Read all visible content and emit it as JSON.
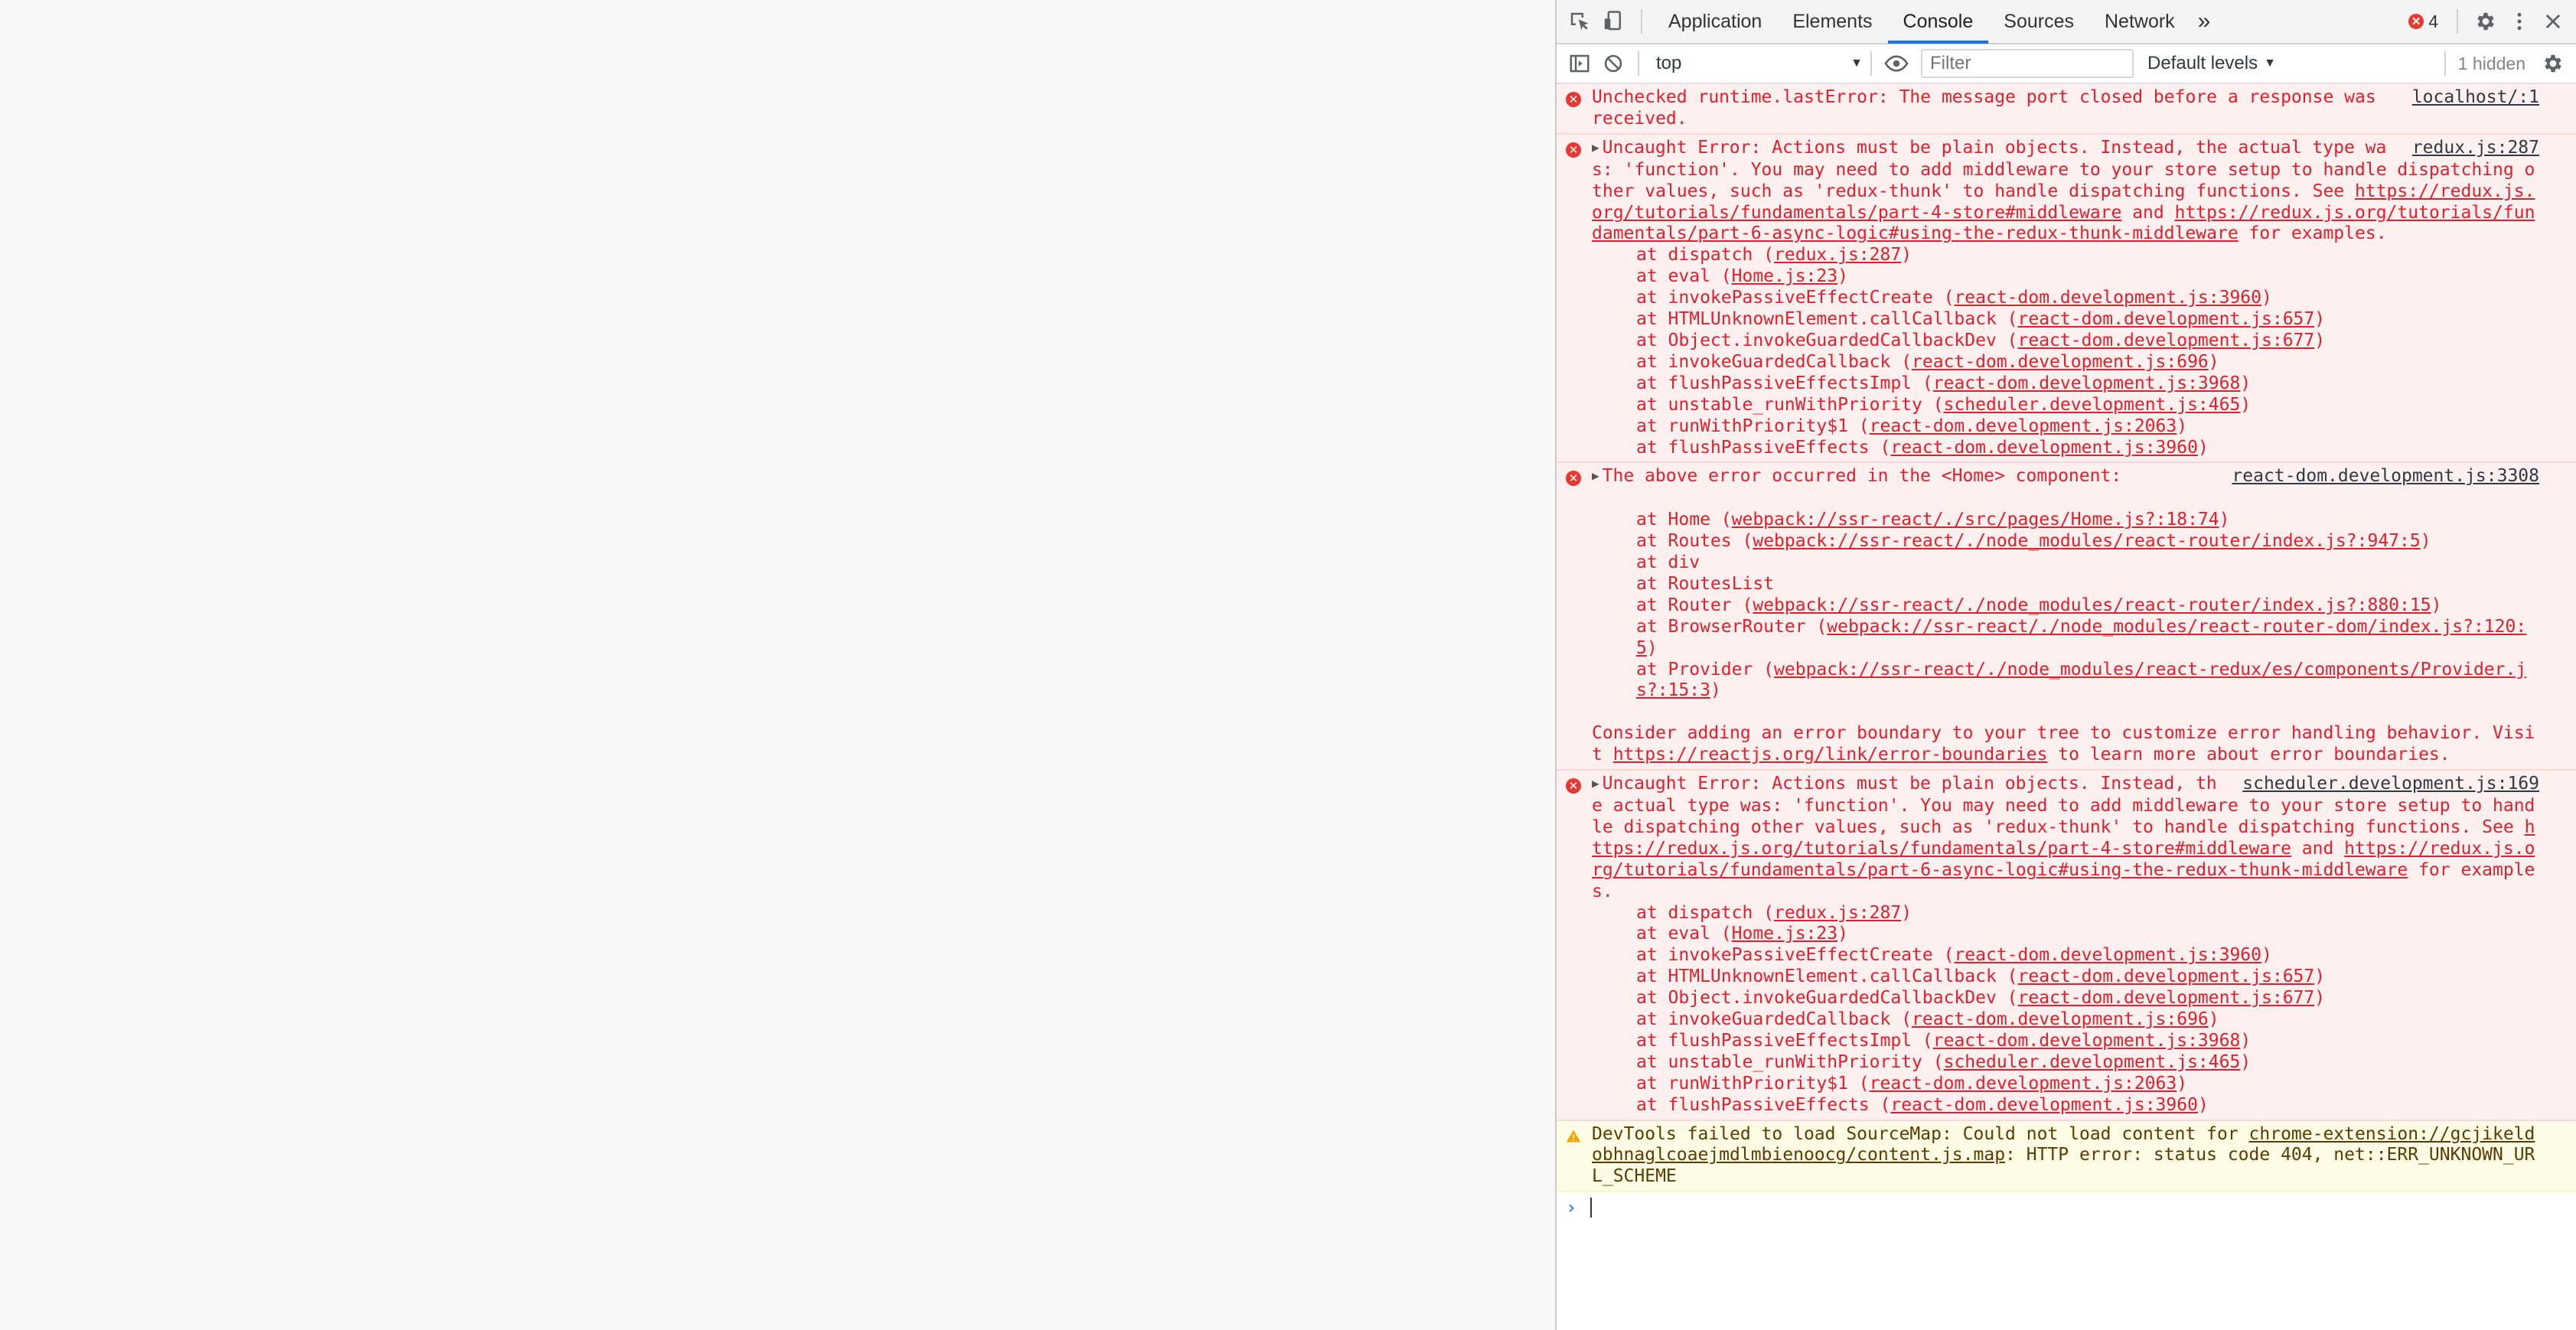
{
  "tabs": [
    "Application",
    "Elements",
    "Console",
    "Sources",
    "Network"
  ],
  "active_tab": "Console",
  "more_tabs_label": "»",
  "error_count": "4",
  "toolbar": {
    "context": "top",
    "filter_placeholder": "Filter",
    "levels": "Default levels",
    "hidden": "1 hidden"
  },
  "icons": {
    "inspect": "inspect-element-icon",
    "device": "device-toolbar-icon",
    "settings": "gear-icon",
    "menu": "more-vert-icon",
    "close": "close-icon",
    "sidebar": "sidebar-toggle-icon",
    "clear": "clear-console-icon",
    "eye": "live-expression-icon"
  },
  "colors": {
    "error_bg": "#fff0f0",
    "error_text": "#e0212d",
    "warn_bg": "#fffbe5",
    "accent": "#1a73e8"
  },
  "messages": [
    {
      "type": "error",
      "expandable": false,
      "source": "localhost/:1",
      "text": [
        {
          "t": "Unchecked runtime.lastError: The message port closed before a response was received."
        }
      ],
      "stack": []
    },
    {
      "type": "error",
      "expandable": true,
      "source": "redux.js:287",
      "text": [
        {
          "t": "Uncaught Error: Actions must be plain objects. Instead, the actual type was: 'function'. You may need to add middleware to your store setup to handle dispatching other values, such as 'redux-thunk' to handle dispatching functions. See "
        },
        {
          "t": "https://redux.js.org/tutorials/fundamentals/part-4-store#middleware",
          "link": true
        },
        {
          "t": " and "
        },
        {
          "t": "https://redux.js.org/tutorials/fundamentals/part-6-async-logic#using-the-redux-thunk-middleware",
          "link": true
        },
        {
          "t": " for examples."
        }
      ],
      "stack": [
        {
          "fn": "dispatch",
          "loc": "redux.js:287"
        },
        {
          "fn": "eval",
          "loc": "Home.js:23"
        },
        {
          "fn": "invokePassiveEffectCreate",
          "loc": "react-dom.development.js:3960"
        },
        {
          "fn": "HTMLUnknownElement.callCallback",
          "loc": "react-dom.development.js:657"
        },
        {
          "fn": "Object.invokeGuardedCallbackDev",
          "loc": "react-dom.development.js:677"
        },
        {
          "fn": "invokeGuardedCallback",
          "loc": "react-dom.development.js:696"
        },
        {
          "fn": "flushPassiveEffectsImpl",
          "loc": "react-dom.development.js:3968"
        },
        {
          "fn": "unstable_runWithPriority",
          "loc": "scheduler.development.js:465"
        },
        {
          "fn": "runWithPriority$1",
          "loc": "react-dom.development.js:2063"
        },
        {
          "fn": "flushPassiveEffects",
          "loc": "react-dom.development.js:3960"
        }
      ]
    },
    {
      "type": "error",
      "expandable": true,
      "source": "react-dom.development.js:3308",
      "text": [
        {
          "t": "The above error occurred in the <Home> component:"
        }
      ],
      "stack_gap_before": true,
      "stack": [
        {
          "fn": "Home",
          "loc": "webpack://ssr-react/./src/pages/Home.js?:18:74"
        },
        {
          "fn": "Routes",
          "loc": "webpack://ssr-react/./node_modules/react-router/index.js?:947:5"
        },
        {
          "fn": "div"
        },
        {
          "fn": "RoutesList"
        },
        {
          "fn": "Router",
          "loc": "webpack://ssr-react/./node_modules/react-router/index.js?:880:15"
        },
        {
          "fn": "BrowserRouter",
          "loc": "webpack://ssr-react/./node_modules/react-router-dom/index.js?:120:5"
        },
        {
          "fn": "Provider",
          "loc": "webpack://ssr-react/./node_modules/react-redux/es/components/Provider.js?:15:3"
        }
      ],
      "footer": [
        {
          "t": "Consider adding an error boundary to your tree to customize error handling behavior. Visit "
        },
        {
          "t": "https://reactjs.org/link/error-boundaries",
          "link": true
        },
        {
          "t": " to learn more about error boundaries."
        }
      ]
    },
    {
      "type": "error",
      "expandable": true,
      "source": "scheduler.development.js:169",
      "text": [
        {
          "t": "Uncaught Error: Actions must be plain objects. Instead, the actual type was: 'function'. You may need to add middleware to your store setup to handle dispatching other values, such as 'redux-thunk' to handle dispatching functions. See "
        },
        {
          "t": "https://redux.js.org/tutorials/fundamentals/part-4-store#middleware",
          "link": true
        },
        {
          "t": " and "
        },
        {
          "t": "https://redux.js.org/tutorials/fundamentals/part-6-async-logic#using-the-redux-thunk-middleware",
          "link": true
        },
        {
          "t": " for examples."
        }
      ],
      "stack": [
        {
          "fn": "dispatch",
          "loc": "redux.js:287"
        },
        {
          "fn": "eval",
          "loc": "Home.js:23"
        },
        {
          "fn": "invokePassiveEffectCreate",
          "loc": "react-dom.development.js:3960"
        },
        {
          "fn": "HTMLUnknownElement.callCallback",
          "loc": "react-dom.development.js:657"
        },
        {
          "fn": "Object.invokeGuardedCallbackDev",
          "loc": "react-dom.development.js:677"
        },
        {
          "fn": "invokeGuardedCallback",
          "loc": "react-dom.development.js:696"
        },
        {
          "fn": "flushPassiveEffectsImpl",
          "loc": "react-dom.development.js:3968"
        },
        {
          "fn": "unstable_runWithPriority",
          "loc": "scheduler.development.js:465"
        },
        {
          "fn": "runWithPriority$1",
          "loc": "react-dom.development.js:2063"
        },
        {
          "fn": "flushPassiveEffects",
          "loc": "react-dom.development.js:3960"
        }
      ]
    },
    {
      "type": "warn",
      "expandable": false,
      "source": "",
      "text": [
        {
          "t": "DevTools failed to load SourceMap: Could not load content for "
        },
        {
          "t": "chrome-extension://gcjikeldobhnaglcoaejmdlmbienoocg/content.js.map",
          "link": true
        },
        {
          "t": ": HTTP error: status code 404, net::ERR_UNKNOWN_URL_SCHEME"
        }
      ],
      "stack": []
    }
  ],
  "prompt_symbol": "›"
}
